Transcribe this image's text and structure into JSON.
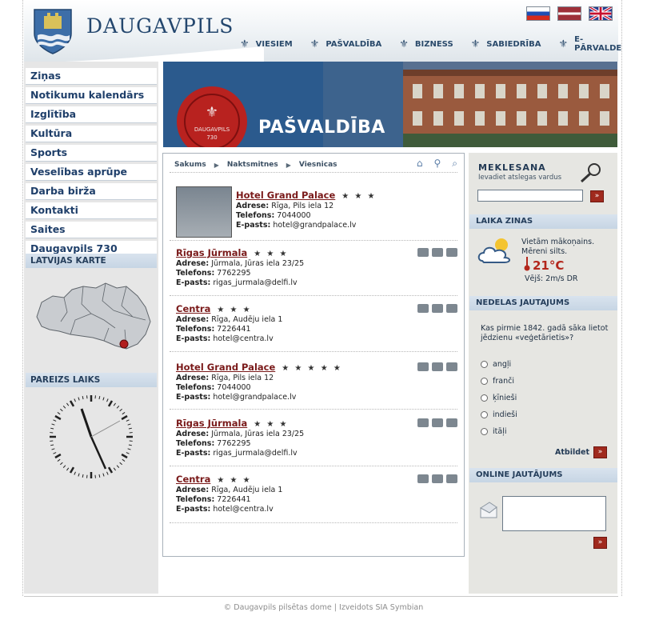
{
  "header": {
    "brand": "DAUGAVPILS",
    "nav": [
      {
        "label": "VIESIEM"
      },
      {
        "label": "PAŠVALDĪBA"
      },
      {
        "label": "BIZNESS"
      },
      {
        "label": "SABIEDRĪBA"
      },
      {
        "label": "E-PĀRVALDE"
      }
    ],
    "flags": [
      "russian-flag-icon",
      "latvian-flag-icon",
      "uk-flag-icon"
    ]
  },
  "sidebar": {
    "items": [
      {
        "label": "Ziņas"
      },
      {
        "label": "Notikumu kalendārs"
      },
      {
        "label": "Izglītība"
      },
      {
        "label": "Kultūra"
      },
      {
        "label": "Sports"
      },
      {
        "label": "Veselības aprūpe"
      },
      {
        "label": "Darba birža"
      },
      {
        "label": "Kontakti"
      },
      {
        "label": "Saites"
      },
      {
        "label": "Daugavpils 730"
      }
    ],
    "map_title": "LATVIJAS KARTE",
    "clock_title": "PAREIZS LAIKS"
  },
  "banner": {
    "title": "PAŠVALDĪBA",
    "seal_text": "DAUGAVPILS 730"
  },
  "breadcrumb": [
    "Sakums",
    "Naktsmitnes",
    "Viesnicas"
  ],
  "hotels": [
    {
      "name": "Hotel Grand Palace",
      "stars": "★ ★ ★",
      "address": "Rīga, Pils iela 12",
      "phone": "7044000",
      "email": "hotel@grandpalace.lv"
    },
    {
      "name": "Rīgas Jūrmala",
      "stars": "★ ★ ★",
      "address": "Jūrmala, Jūras iela 23/25",
      "phone": "7762295",
      "email": "rigas_jurmala@delfi.lv"
    },
    {
      "name": "Centra",
      "stars": "★ ★ ★",
      "address": "Rīga, Audēju iela 1",
      "phone": "7226441",
      "email": "hotel@centra.lv"
    },
    {
      "name": "Hotel Grand Palace",
      "stars": "★ ★ ★ ★ ★",
      "address": "Rīga, Pils iela 12",
      "phone": "7044000",
      "email": "hotel@grandpalace.lv"
    },
    {
      "name": "Rīgas Jūrmala",
      "stars": "★ ★ ★",
      "address": "Jūrmala, Jūras iela 23/25",
      "phone": "7762295",
      "email": "rigas_jurmala@delfi.lv"
    },
    {
      "name": "Centra",
      "stars": "★ ★ ★",
      "address": "Rīga, Audēju iela 1",
      "phone": "7226441",
      "email": "hotel@centra.lv"
    }
  ],
  "labels": {
    "address": "Adrese:",
    "phone": "Telefons:",
    "email": "E-pasts:"
  },
  "search": {
    "title": "MEKLESANA",
    "hint": "Ievadiet atslegas vardus",
    "value": ""
  },
  "weather": {
    "title": "LAIKA ZINAS",
    "line1": "Vietām mākoņains.",
    "line2": "Mēreni silts.",
    "temp": "21°C",
    "wind": "Vējš: 2m/s DR"
  },
  "poll": {
    "title": "NEDELAS JAUTAJUMS",
    "question": "Kas pirmie 1842. gadā sāka lietot jēdzienu «veģetārietis»?",
    "options": [
      "angļi",
      "franči",
      "ķīnieši",
      "indieši",
      "itāļi"
    ],
    "submit": "Atbildet"
  },
  "online": {
    "title": "ONLINE JAUTĀJUMS",
    "value": ""
  },
  "footer": "© Daugavpils pilsētas dome | Izveidots SIA Symbian",
  "colors": {
    "accent": "#7a1a1a",
    "navy": "#1f3f6a",
    "button": "#a02a1e"
  }
}
